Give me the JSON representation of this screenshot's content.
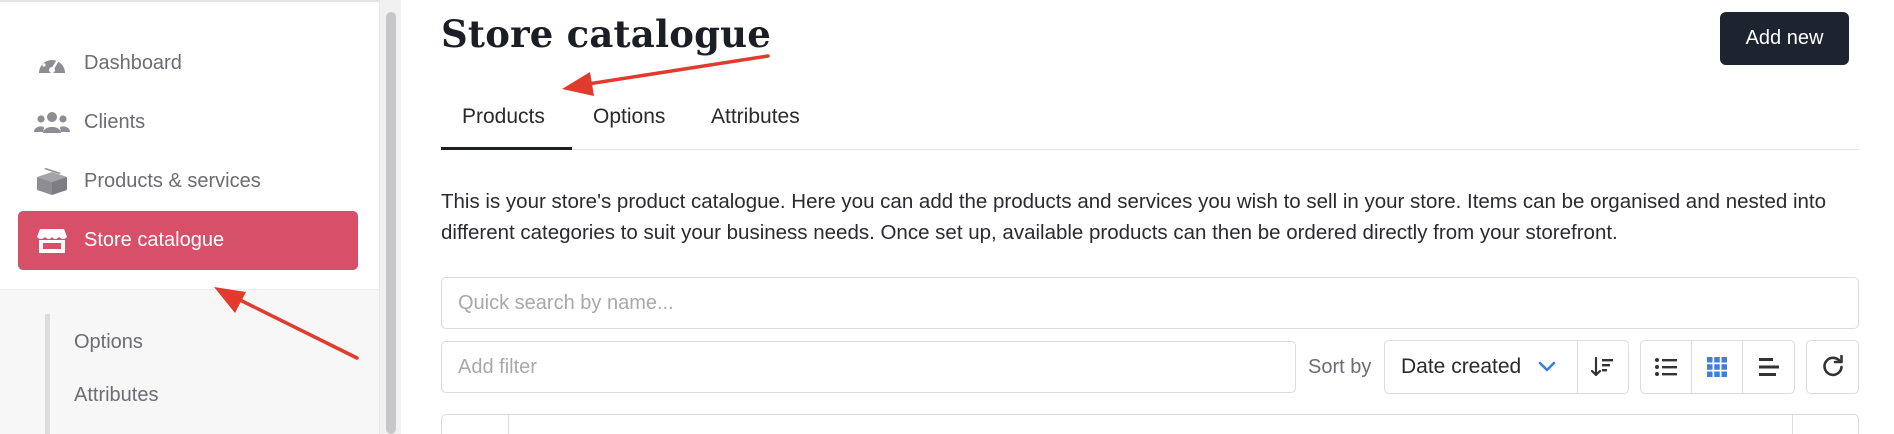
{
  "sidebar": {
    "items": [
      {
        "label": "Dashboard",
        "icon": "dashboard-gauge-icon",
        "active": false
      },
      {
        "label": "Clients",
        "icon": "users-icon",
        "active": false
      },
      {
        "label": "Products & services",
        "icon": "boxes-icon",
        "active": false
      },
      {
        "label": "Store catalogue",
        "icon": "store-icon",
        "active": true
      }
    ],
    "subitems": [
      {
        "label": "Options"
      },
      {
        "label": "Attributes"
      }
    ]
  },
  "header": {
    "title": "Store catalogue",
    "add_button": "Add new"
  },
  "tabs": [
    {
      "label": "Products",
      "active": true
    },
    {
      "label": "Options",
      "active": false
    },
    {
      "label": "Attributes",
      "active": false
    }
  ],
  "description": "This is your store's product catalogue. Here you can add the products and services you wish to sell in your store. Items can be organised and nested into different categories to suit your business needs. Once set up, available products can then be ordered directly from your storefront.",
  "search": {
    "placeholder": "Quick search by name...",
    "value": ""
  },
  "filter": {
    "placeholder": "Add filter",
    "value": ""
  },
  "sort": {
    "label": "Sort by",
    "selected": "Date created",
    "order_icon": "sort-descending-icon"
  },
  "view_toggles": [
    {
      "icon": "list-view-icon",
      "active": false
    },
    {
      "icon": "grid-view-icon",
      "active": true
    },
    {
      "icon": "align-view-icon",
      "active": false
    }
  ],
  "refresh_icon": "refresh-icon",
  "colors": {
    "active_nav": "#d74f68",
    "primary_button": "#1d2430",
    "annotation_arrow": "#e23b2e",
    "active_view_icon": "#3d7fd9"
  }
}
